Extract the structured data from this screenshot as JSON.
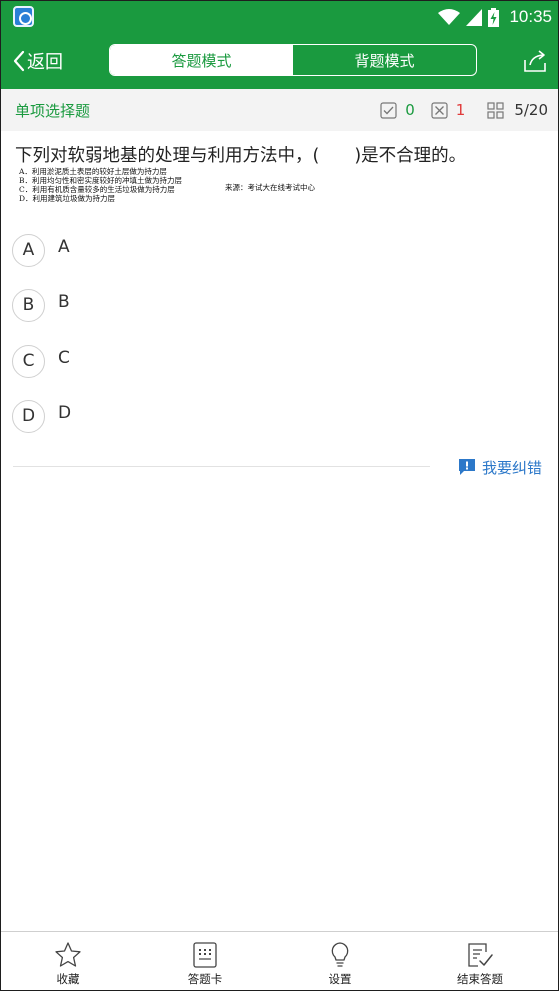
{
  "status": {
    "time": "10:35",
    "icons": [
      "app-icon",
      "wifi-icon",
      "signal-icon",
      "battery-charging-icon"
    ]
  },
  "header": {
    "back_label": "返回",
    "tabs": [
      {
        "label": "答题模式",
        "active": true
      },
      {
        "label": "背题模式",
        "active": false
      }
    ],
    "share_icon": "share-icon"
  },
  "subbar": {
    "question_type": "单项选择题",
    "correct_count": "0",
    "wrong_count": "1",
    "progress": "5/20"
  },
  "question": {
    "text": "下列对软弱地基的处理与利用方法中，(　　)是不合理的。",
    "image_options": [
      "A．利用淤泥质土表层的较好土层做为持力层",
      "B．利用均匀性和密实度较好的冲填土做为持力层",
      "C．利用有机质含量较多的生活垃圾做为持力层",
      "D．利用建筑垃圾做为持力层"
    ],
    "image_source": "来源：考试大在线考试中心"
  },
  "options": [
    {
      "letter": "A",
      "text": "A"
    },
    {
      "letter": "B",
      "text": "B"
    },
    {
      "letter": "C",
      "text": "C"
    },
    {
      "letter": "D",
      "text": "D"
    }
  ],
  "report_label": "我要纠错",
  "bottom_nav": [
    {
      "label": "收藏",
      "icon": "star-icon"
    },
    {
      "label": "答题卡",
      "icon": "answer-card-icon"
    },
    {
      "label": "设置",
      "icon": "lightbulb-icon"
    },
    {
      "label": "结束答题",
      "icon": "finish-icon"
    }
  ],
  "colors": {
    "primary": "#1a9a3f",
    "wrong": "#e03a3a",
    "link": "#2c78c9"
  }
}
